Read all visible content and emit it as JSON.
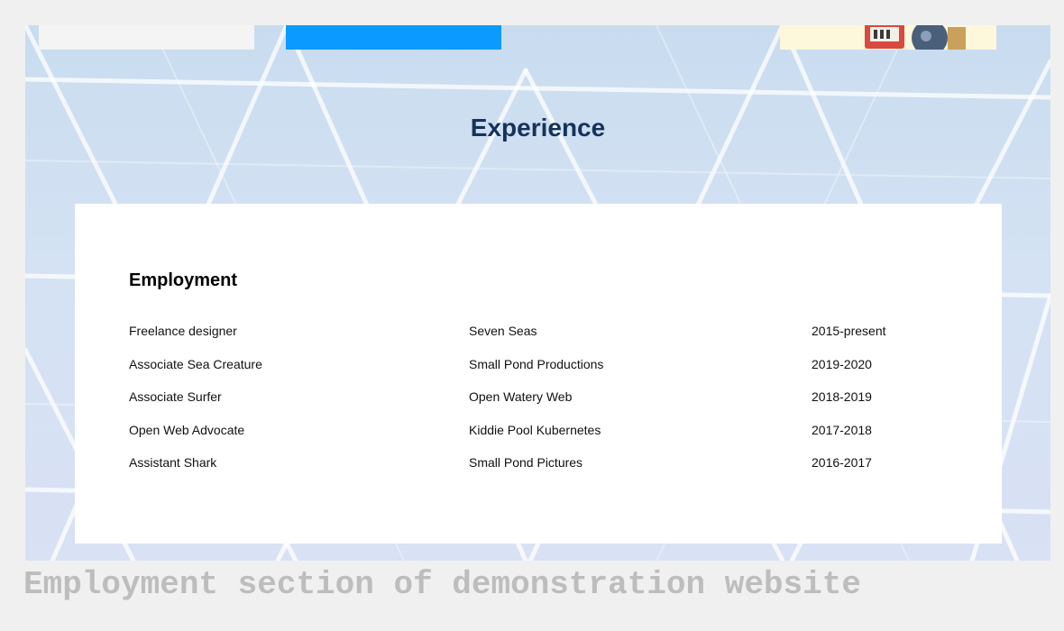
{
  "section": {
    "title": "Experience"
  },
  "employment": {
    "heading": "Employment",
    "rows": [
      {
        "role": "Freelance designer",
        "company": "Seven Seas",
        "years": "2015-present"
      },
      {
        "role": "Associate Sea Creature",
        "company": "Small Pond Productions",
        "years": "2019-2020"
      },
      {
        "role": "Associate Surfer",
        "company": "Open Watery Web",
        "years": "2018-2019"
      },
      {
        "role": "Open Web Advocate",
        "company": "Kiddie Pool Kubernetes",
        "years": "2017-2018"
      },
      {
        "role": "Assistant Shark",
        "company": "Small Pond Pictures",
        "years": "2016-2017"
      }
    ]
  },
  "caption": "Employment section of demonstration website",
  "colors": {
    "title": "#16325c",
    "thumbnail_blue": "#0b9aff",
    "caption_gray": "#bdbdbd"
  }
}
